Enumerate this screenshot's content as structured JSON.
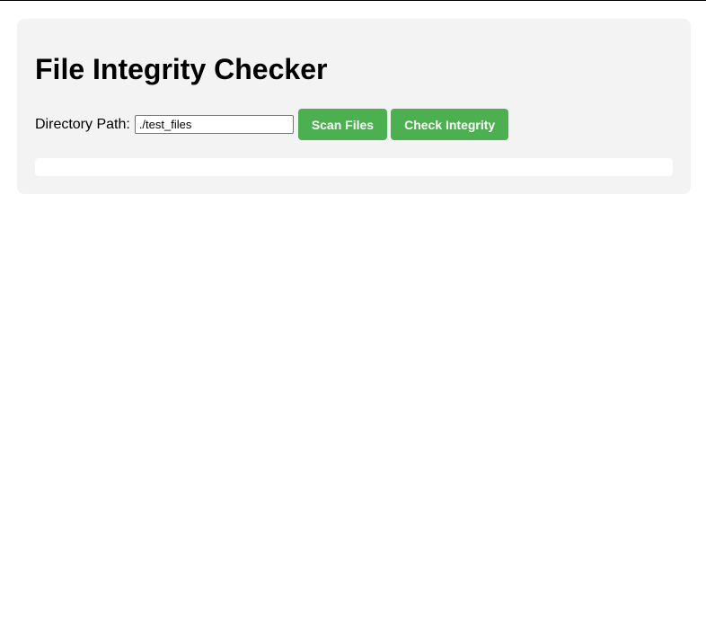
{
  "page": {
    "title": "File Integrity Checker"
  },
  "controls": {
    "directory_label": "Directory Path:",
    "directory_value": "./test_files",
    "scan_button": "Scan Files",
    "check_button": "Check Integrity"
  },
  "results": {
    "text": ""
  },
  "colors": {
    "accent": "#4caf50",
    "panel_background": "#f3f3f3"
  }
}
